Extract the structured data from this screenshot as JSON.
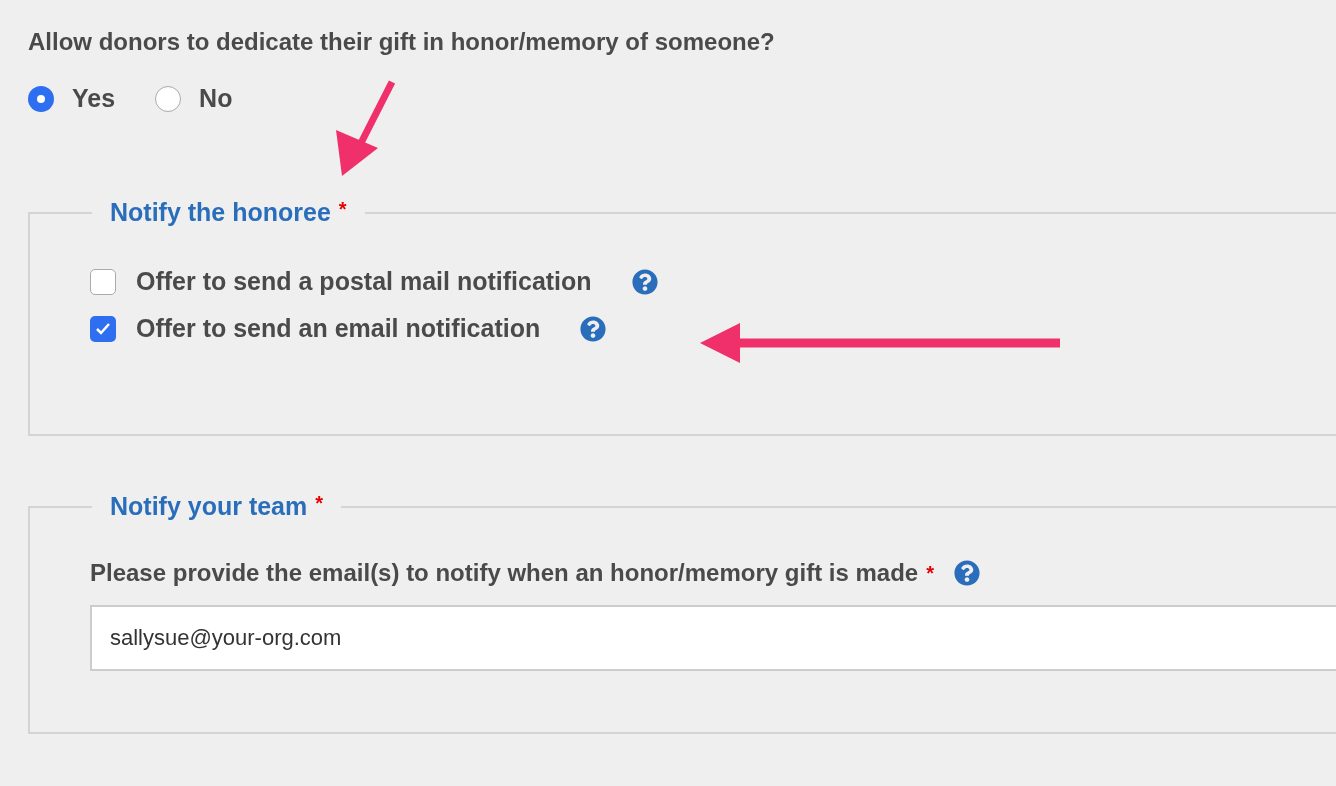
{
  "question": "Allow donors to dedicate their gift in honor/memory of someone?",
  "choices": [
    {
      "label": "Yes",
      "selected": true
    },
    {
      "label": "No",
      "selected": false
    }
  ],
  "sections": [
    {
      "kind": "checkboxes",
      "legend": "Notify the honoree",
      "required_mark": "*",
      "options": [
        {
          "label": "Offer to send a postal mail notification",
          "checked": false
        },
        {
          "label": "Offer to send an email notification",
          "checked": true
        }
      ]
    },
    {
      "kind": "email",
      "legend": "Notify your team",
      "required_mark": "*",
      "field": {
        "label": "Please provide the email(s) to notify when an honor/memory gift is made",
        "required_mark": "*",
        "value": "sallysue@your-org.com"
      }
    }
  ]
}
